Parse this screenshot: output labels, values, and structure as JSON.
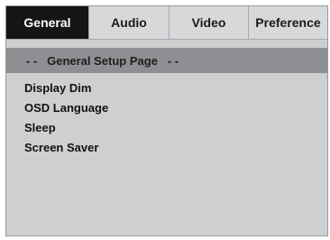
{
  "tabs": [
    {
      "label": "General",
      "active": true
    },
    {
      "label": "Audio",
      "active": false
    },
    {
      "label": "Video",
      "active": false
    },
    {
      "label": "Preference",
      "active": false
    }
  ],
  "page_title": "- -   General Setup Page   - -",
  "menu_items": [
    {
      "label": "Display Dim"
    },
    {
      "label": "OSD Language"
    },
    {
      "label": "Sleep"
    },
    {
      "label": "Screen Saver"
    }
  ],
  "colors": {
    "active_tab_bg": "#151515",
    "panel_bg": "#cfcfd2",
    "title_bar_bg": "#8f8f93"
  }
}
